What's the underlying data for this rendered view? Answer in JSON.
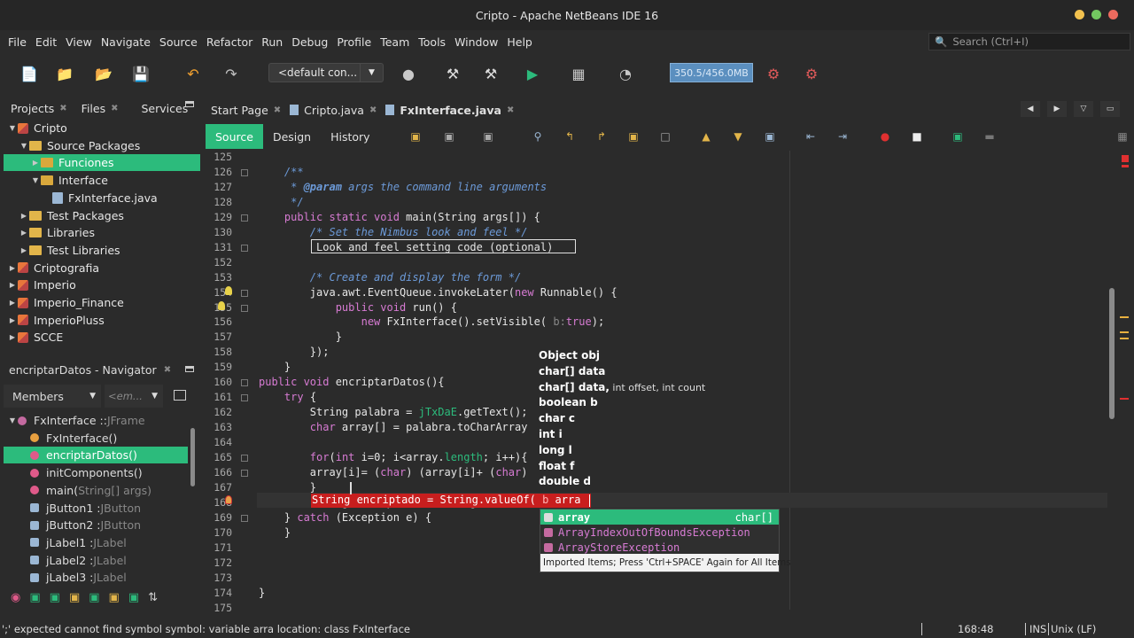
{
  "window": {
    "title": "Cripto - Apache NetBeans IDE 16"
  },
  "menu": [
    "File",
    "Edit",
    "View",
    "Navigate",
    "Source",
    "Refactor",
    "Run",
    "Debug",
    "Profile",
    "Team",
    "Tools",
    "Window",
    "Help"
  ],
  "search": {
    "placeholder": "Search (Ctrl+I)"
  },
  "toolbar": {
    "config": "<default con...",
    "memory": "350.5/456.0MB"
  },
  "project_tabs": [
    "Projects",
    "Files",
    "Services"
  ],
  "tree": [
    {
      "label": "Cripto",
      "kind": "project",
      "level": 0,
      "expanded": true
    },
    {
      "label": "Source Packages",
      "kind": "folder",
      "level": 1,
      "expanded": true
    },
    {
      "label": "Funciones",
      "kind": "package",
      "level": 2,
      "expanded": false,
      "selected": true
    },
    {
      "label": "Interface",
      "kind": "package",
      "level": 2,
      "expanded": true
    },
    {
      "label": "FxInterface.java",
      "kind": "java",
      "level": 3
    },
    {
      "label": "Test Packages",
      "kind": "folder",
      "level": 1
    },
    {
      "label": "Libraries",
      "kind": "folder",
      "level": 1
    },
    {
      "label": "Test Libraries",
      "kind": "folder",
      "level": 1
    },
    {
      "label": "Criptografia",
      "kind": "project",
      "level": 0
    },
    {
      "label": "Imperio",
      "kind": "project",
      "level": 0
    },
    {
      "label": "Imperio_Finance",
      "kind": "project",
      "level": 0
    },
    {
      "label": "ImperioPluss",
      "kind": "project",
      "level": 0
    },
    {
      "label": "SCCE",
      "kind": "project",
      "level": 0
    }
  ],
  "navigator": {
    "title": "encriptarDatos - Navigator",
    "members_label": "Members",
    "filter_placeholder": "<em...",
    "items": [
      {
        "name": "FxInterface :: ",
        "type": "JFrame",
        "level": 0
      },
      {
        "name": "FxInterface()",
        "type": "",
        "level": 1
      },
      {
        "name": "encriptarDatos()",
        "type": "",
        "level": 1,
        "selected": true
      },
      {
        "name": "initComponents()",
        "type": "",
        "level": 1
      },
      {
        "name": "main(",
        "type": "String[] args)",
        "level": 1
      },
      {
        "name": "jButton1 : ",
        "type": "JButton",
        "level": 1
      },
      {
        "name": "jButton2 : ",
        "type": "JButton",
        "level": 1
      },
      {
        "name": "jLabel1 : ",
        "type": "JLabel",
        "level": 1
      },
      {
        "name": "jLabel2 : ",
        "type": "JLabel",
        "level": 1
      },
      {
        "name": "jLabel3 : ",
        "type": "JLabel",
        "level": 1
      }
    ]
  },
  "editor_tabs": [
    {
      "label": "Start Page"
    },
    {
      "label": "Cripto.java"
    },
    {
      "label": "FxInterface.java",
      "active": true
    }
  ],
  "editor_modes": [
    "Source",
    "Design",
    "History"
  ],
  "code": [
    {
      "n": "125",
      "html": ""
    },
    {
      "n": "126",
      "html": "<span class='cm'>    /**</span>"
    },
    {
      "n": "127",
      "html": "<span class='cm'>     * <b>@param</b> args the command line arguments</span>"
    },
    {
      "n": "128",
      "html": "<span class='cm'>     */</span>"
    },
    {
      "n": "129",
      "html": "    <span class='kw'>public static void</span> main(String args[]) {"
    },
    {
      "n": "130",
      "html": "<span class='cm'>        /* Set the Nimbus look and feel */</span>"
    },
    {
      "n": "131",
      "html": "         Look and feel setting code (optional)"
    },
    {
      "n": "152",
      "html": ""
    },
    {
      "n": "153",
      "html": "<span class='cm'>        /* Create and display the form */</span>"
    },
    {
      "n": "154",
      "html": "        java.awt.EventQueue.invokeLater(<span class='kw'>new</span> Runnable() {"
    },
    {
      "n": "155",
      "html": "            <span class='kw'>public void</span> run() {"
    },
    {
      "n": "156",
      "html": "                <span class='kw'>new</span> FxInterface().setVisible( <span class='gray'>b:</span><span class='kw'>true</span>);"
    },
    {
      "n": "157",
      "html": "            }"
    },
    {
      "n": "158",
      "html": "        });"
    },
    {
      "n": "159",
      "html": "    }"
    },
    {
      "n": "160",
      "html": "<span class='kw'>public void</span> encriptarDatos(){"
    },
    {
      "n": "161",
      "html": "    <span class='kw'>try</span> {"
    },
    {
      "n": "162",
      "html": "        String palabra = <span class='fld'>jTxDaE</span>.getText();"
    },
    {
      "n": "163",
      "html": "        <span class='kw'>char</span> array[] = palabra.toCharArray"
    },
    {
      "n": "164",
      "html": ""
    },
    {
      "n": "165",
      "html": "        <span class='kw'>for</span>(<span class='kw'>int</span> i=0; i&lt;array.<span class='fld'>length</span>; i++){"
    },
    {
      "n": "166",
      "html": "        array[i]= (<span class='kw'>char</span>) (array[i]+ (<span class='kw'>char</span>)"
    },
    {
      "n": "167",
      "html": "        }"
    },
    {
      "n": "168",
      "html": "        String encriptado = String.valueOf( <span style='color:#ffb3b3'>b</span> arra"
    },
    {
      "n": "169",
      "html": "    } <span class='kw'>catch</span> (Exception e) {"
    },
    {
      "n": "170",
      "html": "    }"
    },
    {
      "n": "171",
      "html": ""
    },
    {
      "n": "172",
      "html": ""
    },
    {
      "n": "173",
      "html": ""
    },
    {
      "n": "174",
      "html": "}"
    },
    {
      "n": "175",
      "html": ""
    }
  ],
  "param_popup": [
    {
      "main": "Object obj",
      "rest": ""
    },
    {
      "main": "char[] data",
      "rest": ""
    },
    {
      "main": "char[] data,",
      "rest": " int offset, int count"
    },
    {
      "main": "boolean b",
      "rest": ""
    },
    {
      "main": "char c",
      "rest": ""
    },
    {
      "main": "int i",
      "rest": ""
    },
    {
      "main": "long l",
      "rest": ""
    },
    {
      "main": "float f",
      "rest": ""
    },
    {
      "main": "double d",
      "rest": ""
    }
  ],
  "completion": {
    "items": [
      {
        "label": "array",
        "type": "char[]",
        "selected": true
      },
      {
        "label": "ArrayIndexOutOfBoundsException",
        "type": ""
      },
      {
        "label": "ArrayStoreException",
        "type": ""
      }
    ],
    "footer": "Imported Items; Press 'Ctrl+SPACE' Again for All Items"
  },
  "status": {
    "message": "';' expected  cannot find symbol  symbol:  variable arra  location: class FxInterface",
    "position": "168:48",
    "mode": "INS",
    "line_ending": "Unix (LF)"
  },
  "colors": {
    "accent": "#2cbb7c",
    "error": "#c81e1e",
    "keyword": "#d77bd3",
    "comment": "#6c9ad8"
  }
}
